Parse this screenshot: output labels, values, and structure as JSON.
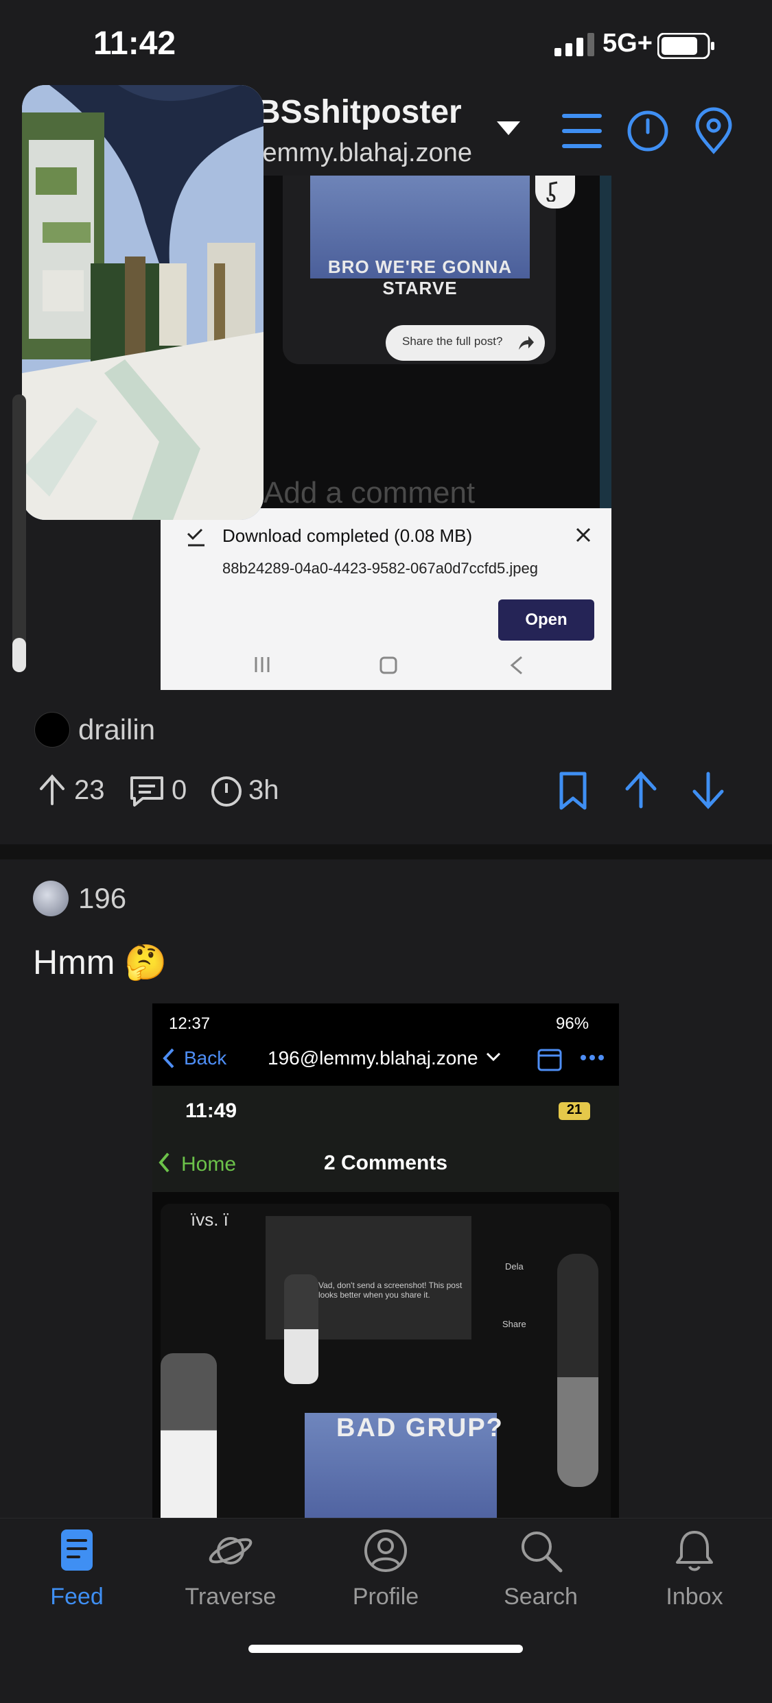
{
  "status_bar": {
    "time": "11:42",
    "network": "5G+"
  },
  "header": {
    "community": "BSshitposter",
    "instance": "lemmy.blahaj.zone"
  },
  "posts": [
    {
      "embedded": {
        "image_text": "BRO WE'RE GONNA STARVE",
        "share_prompt": "Share the full post?",
        "comment_placeholder": "Add a comment",
        "download_title": "Download completed (0.08 MB)",
        "download_file": "88b24289-04a0-4423-9582-067a0d7ccfd5.jpeg",
        "open_label": "Open"
      },
      "author": "drailin",
      "upvotes": "23",
      "comments": "0",
      "age": "3h"
    },
    {
      "author": "196",
      "title": "Hmm 🤔",
      "embedded": {
        "time": "12:37",
        "battery": "96%",
        "back_label": "Back",
        "account": "196@lemmy.blahaj.zone",
        "inner_time": "11:49",
        "inner_battery": "21",
        "home_label": "Home",
        "comments_title": "2 Comments",
        "overlay_text": "ïvs. ï",
        "dela_label": "Dela",
        "share_label": "Share",
        "dialog_text": "Vad, don't send a screenshot! This post looks better when you share it.",
        "image_text": "BAD GRUP?"
      }
    }
  ],
  "nav": [
    {
      "label": "Feed",
      "icon": "feed-icon",
      "active": true
    },
    {
      "label": "Traverse",
      "icon": "planet-icon"
    },
    {
      "label": "Profile",
      "icon": "profile-icon"
    },
    {
      "label": "Search",
      "icon": "search-icon"
    },
    {
      "label": "Inbox",
      "icon": "bell-icon"
    }
  ],
  "colors": {
    "accent": "#3f8ff3",
    "background": "#1c1c1e",
    "download_button": "#252456"
  }
}
